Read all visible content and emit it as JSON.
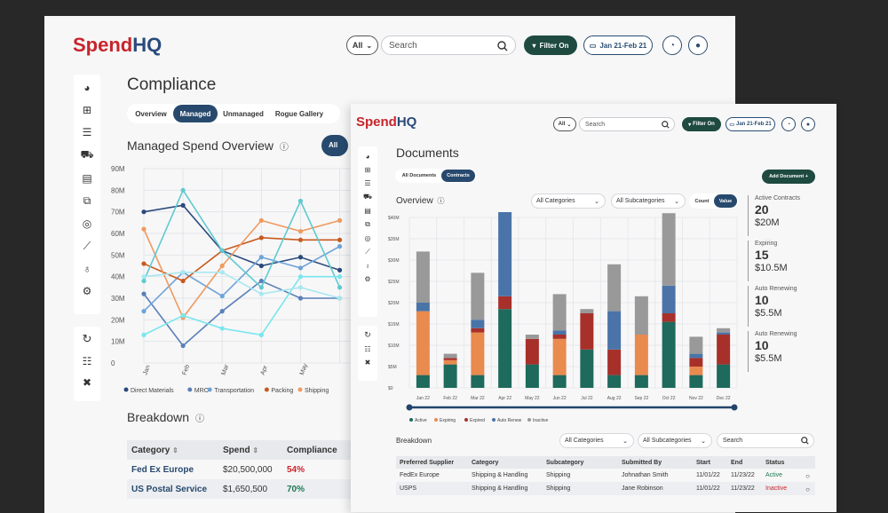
{
  "winA": {
    "logo": {
      "spend": "Spend",
      "hq": "HQ"
    },
    "header": {
      "all_label": "All",
      "search_placeholder": "Search",
      "filter_label": "Filter On",
      "date_label": "Jan 21-Feb 21"
    },
    "title": "Compliance",
    "tabs": [
      {
        "label": "Overview"
      },
      {
        "label": "Managed"
      },
      {
        "label": "Unmanaged"
      },
      {
        "label": "Rogue Gallery"
      }
    ],
    "section_title": "Managed Spend Overview",
    "all_chip": "All",
    "breakdown_title": "Breakdown",
    "table": {
      "columns": [
        "Category",
        "Spend",
        "Compliance"
      ],
      "rows": [
        {
          "category": "Fed Ex Europe",
          "spend": "$20,500,000",
          "compliance": "54%",
          "compliance_color": "#c8242a"
        },
        {
          "category": "US Postal Service",
          "spend": "$1,650,500",
          "compliance": "70%",
          "compliance_color": "#1e7a52"
        }
      ]
    },
    "chart_data": {
      "type": "line",
      "categories": [
        "Jan",
        "Feb",
        "Mar",
        "Apr",
        "May",
        ""
      ],
      "yticks": [
        "90M",
        "80M",
        "70M",
        "60M",
        "50M",
        "40M",
        "30M",
        "20M",
        "10M",
        "0"
      ],
      "ylim": [
        0,
        90
      ],
      "series": [
        {
          "name": "Direct Materials",
          "color": "#2a4a7a",
          "values": [
            70,
            73,
            52,
            45,
            49,
            43
          ]
        },
        {
          "name": "MRO",
          "color": "#5b7fb8",
          "values": [
            32,
            8,
            24,
            38,
            30,
            30
          ]
        },
        {
          "name": "Transportation",
          "color": "#6fa3d8",
          "values": [
            24,
            42,
            31,
            49,
            44,
            54
          ]
        },
        {
          "name": "Packing",
          "color": "#c85a1e",
          "values": [
            46,
            38,
            52,
            58,
            57,
            57
          ]
        },
        {
          "name": "Shipping",
          "color": "#f09a60",
          "values": [
            62,
            21,
            45,
            66,
            61,
            66
          ]
        },
        {
          "name": "",
          "color": "#5fcad1",
          "values": [
            38,
            80,
            52,
            35,
            75,
            35
          ]
        },
        {
          "name": "",
          "color": "#7ae6ee",
          "values": [
            13,
            22,
            16,
            13,
            40,
            40
          ]
        },
        {
          "name": "",
          "color": "#a8e8f0",
          "values": [
            40,
            42,
            42,
            32,
            35,
            30
          ]
        }
      ],
      "legend": [
        "Direct Materials",
        "MRO",
        "Transportation",
        "Packing",
        "Shipping"
      ]
    }
  },
  "winB": {
    "logo": {
      "spend": "Spend",
      "hq": "HQ"
    },
    "header": {
      "all_label": "All",
      "search_placeholder": "Search",
      "filter_label": "Filter On",
      "date_label": "Jan 21-Feb 21"
    },
    "title": "Documents",
    "tabs": [
      {
        "label": "All Documents"
      },
      {
        "label": "Contracts"
      }
    ],
    "add_button": "Add Document +",
    "overview_label": "Overview",
    "dropdown_categories": "All Categories",
    "dropdown_subcategories": "All Subcategories",
    "toggle_count": "Count",
    "toggle_value": "Value",
    "stats": [
      {
        "label": "Active Contracts",
        "count": "20",
        "amount": "$20M"
      },
      {
        "label": "Expiring",
        "count": "15",
        "amount": "$10.5M"
      },
      {
        "label": "Auto Renewing",
        "count": "10",
        "amount": "$5.5M"
      },
      {
        "label": "Auto Renewing",
        "count": "10",
        "amount": "$5.5M"
      }
    ],
    "breakdown_title": "Breakdown",
    "breakdown_search": "Search",
    "table": {
      "columns": [
        "Preferred Supplier",
        "Category",
        "Subcategory",
        "Submitted By",
        "Start",
        "End",
        "Status"
      ],
      "rows": [
        {
          "supplier": "FedEx Europe",
          "category": "Shipping & Handling",
          "subcategory": "Shipping",
          "submitted": "Johnathan Smith",
          "start": "11/01/22",
          "end": "11/23/22",
          "status": "Active",
          "status_color": "#1e7a52"
        },
        {
          "supplier": "USPS",
          "category": "Shipping & Handling",
          "subcategory": "Shipping",
          "submitted": "Jane Robinson",
          "start": "11/01/22",
          "end": "11/23/22",
          "status": "Inactive",
          "status_color": "#c8242a"
        }
      ]
    },
    "chart_data": {
      "type": "bar",
      "stacked": true,
      "categories": [
        "Jan 22",
        "Feb 22",
        "Mar 22",
        "Apr 22",
        "May 22",
        "Jun 22",
        "Jul 22",
        "Aug 22",
        "Sep 22",
        "Oct 22",
        "Nov 22",
        "Dec 22"
      ],
      "yticks": [
        "$40M",
        "$35M",
        "$30M",
        "$25M",
        "$20M",
        "$15M",
        "$10M",
        "$5M",
        "$0"
      ],
      "ylim": [
        0,
        40
      ],
      "series": [
        {
          "name": "Active",
          "color": "#1e6a5c",
          "values": [
            3,
            5.5,
            3,
            18.5,
            5.5,
            3,
            9,
            3,
            3,
            15.5,
            3,
            5.5
          ]
        },
        {
          "name": "Expiring",
          "color": "#e98a4f",
          "values": [
            15,
            1,
            10,
            0,
            0,
            8.5,
            0,
            0,
            9.5,
            0,
            2,
            0
          ]
        },
        {
          "name": "Expired",
          "color": "#a8302a",
          "values": [
            0,
            0.5,
            1,
            3,
            6,
            1,
            8.5,
            6,
            0,
            2,
            2,
            7
          ]
        },
        {
          "name": "Auto Renew",
          "color": "#4a74a8",
          "values": [
            2,
            0,
            2,
            20,
            0,
            1,
            0,
            9,
            0,
            6.5,
            1,
            0.5
          ]
        },
        {
          "name": "Inactive",
          "color": "#999999",
          "values": [
            12,
            1,
            11,
            1,
            1,
            8.5,
            1,
            11,
            9,
            17,
            4,
            1
          ]
        }
      ]
    }
  }
}
